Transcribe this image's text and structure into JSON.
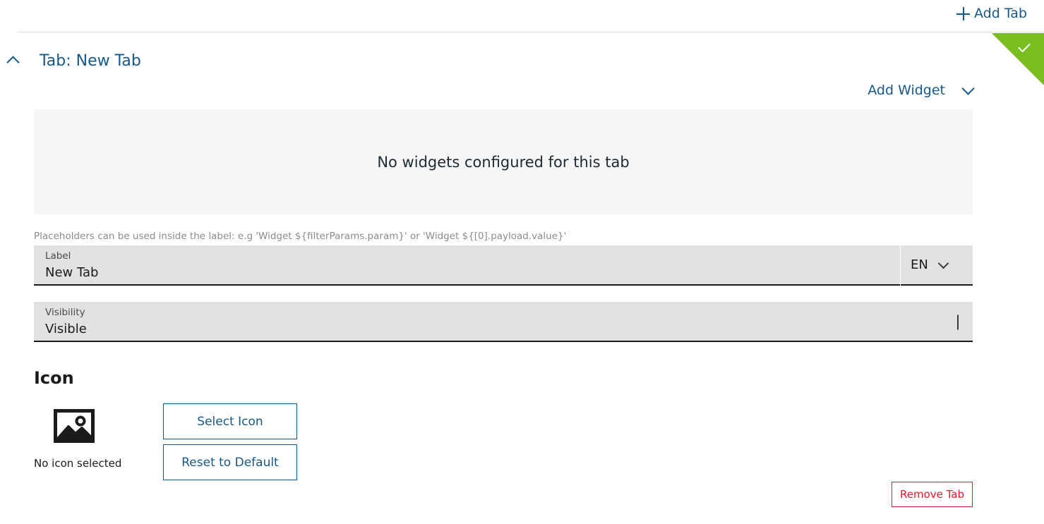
{
  "topbar": {
    "add_tab_label": "Add Tab",
    "add_tab_icon": "plus-icon"
  },
  "status_ribbon": {
    "icon": "check-icon",
    "color": "#78be20"
  },
  "tab_section": {
    "collapse_icon": "chevron-up-icon",
    "title": "Tab: New Tab",
    "add_widget_label": "Add Widget",
    "add_widget_icon": "chevron-down-icon",
    "widgets_empty_text": "No widgets configured for this tab"
  },
  "form": {
    "hint": "Placeholders can be used inside the label: e.g 'Widget ${filterParams.param}' or 'Widget ${[0].payload.value}'",
    "label_field": {
      "label": "Label",
      "value": "New Tab"
    },
    "language_select": {
      "value": "EN",
      "icon": "chevron-down-icon"
    },
    "visibility_field": {
      "label": "Visibility",
      "value": "Visible",
      "icon": "chevron-down-icon"
    }
  },
  "icon_section": {
    "heading": "Icon",
    "preview_icon": "image-placeholder-icon",
    "no_icon_text": "No icon selected",
    "select_icon_label": "Select Icon",
    "reset_default_label": "Reset to Default"
  },
  "actions": {
    "remove_tab_label": "Remove Tab",
    "remove_tab_color": "#e8192c"
  },
  "theme": {
    "accent_blue": "#17588a",
    "success_green": "#78be20",
    "danger_red": "#e8192c",
    "field_bg": "#e0e2e4",
    "panel_bg": "#f6f6f6"
  }
}
